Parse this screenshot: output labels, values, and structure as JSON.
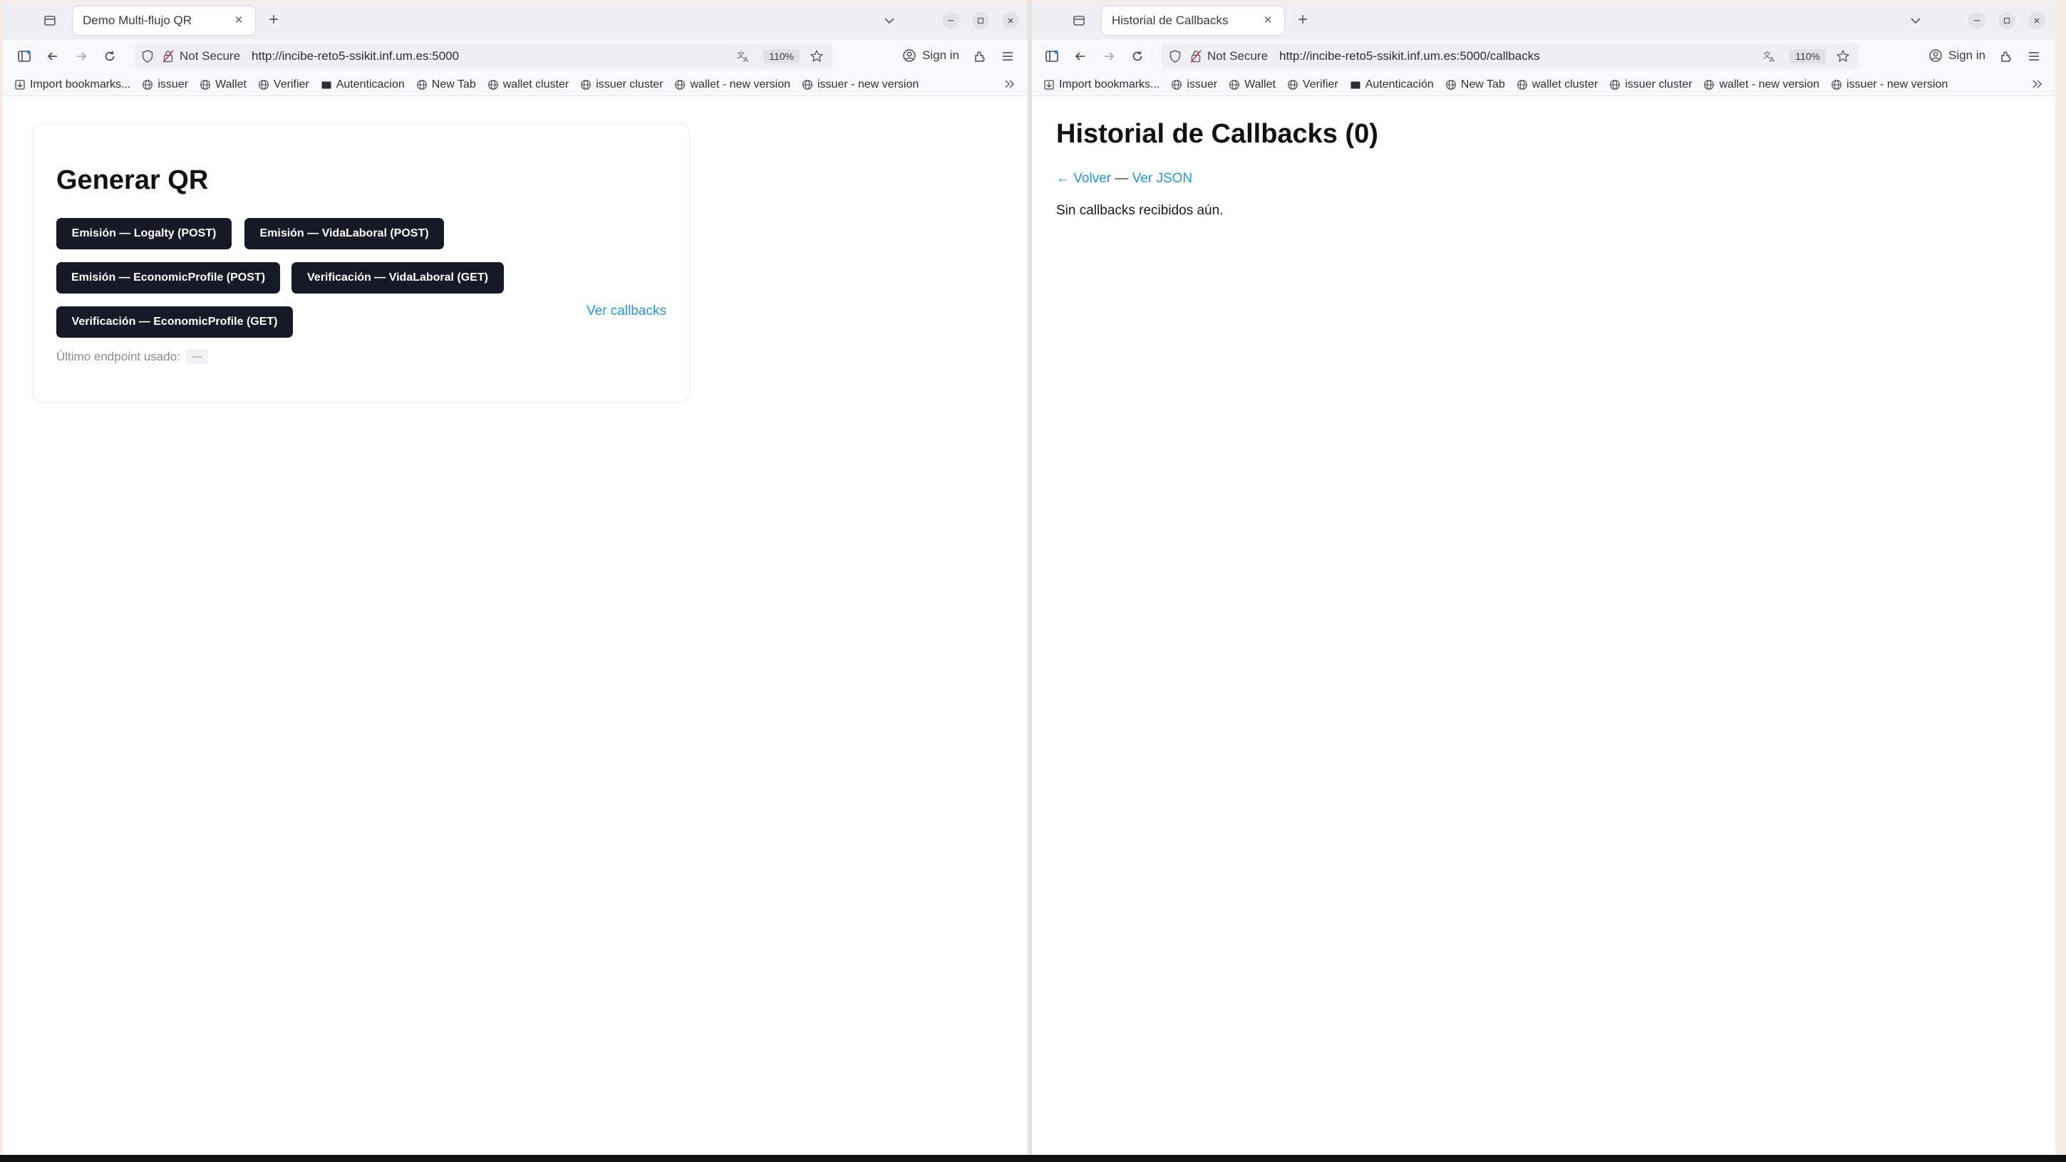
{
  "left": {
    "tab": {
      "title": "Demo Multi-flujo QR",
      "close": "×"
    },
    "new_tab": "+",
    "urlbar": {
      "not_secure": "Not Secure",
      "url": "http://incibe-reto5-ssikit.inf.um.es:5000",
      "zoom": "110%"
    },
    "sign_in": "Sign in",
    "bookmarks": [
      "Import bookmarks...",
      "issuer",
      "Wallet",
      "Verifier",
      "Autenticacion",
      "New Tab",
      "wallet cluster",
      "issuer cluster",
      "wallet - new version",
      "issuer - new version"
    ],
    "page": {
      "title": "Generar QR",
      "buttons": [
        "Emisión — Logalty (POST)",
        "Emisión — VidaLaboral (POST)",
        "Emisión — EconomicProfile (POST)",
        "Verificación — VidaLaboral (GET)",
        "Verificación — EconomicProfile (GET)"
      ],
      "ver_callbacks": "Ver callbacks",
      "last_endpoint_label": "Último endpoint usado:",
      "last_endpoint_value": "—"
    }
  },
  "right": {
    "tab": {
      "title": "Historial de Callbacks",
      "close": "×"
    },
    "new_tab": "+",
    "urlbar": {
      "not_secure": "Not Secure",
      "url": "http://incibe-reto5-ssikit.inf.um.es:5000/callbacks",
      "zoom": "110%"
    },
    "sign_in": "Sign in",
    "bookmarks": [
      "Import bookmarks...",
      "issuer",
      "Wallet",
      "Verifier",
      "Autenticación",
      "New Tab",
      "wallet cluster",
      "issuer cluster",
      "wallet - new version",
      "issuer - new version"
    ],
    "page": {
      "title": "Historial de Callbacks (0)",
      "back_link": "← Volver",
      "separator": " — ",
      "json_link": "Ver JSON",
      "empty_message": "Sin callbacks recibidos aún."
    }
  },
  "icons": {
    "shield": "shield-icon",
    "lock": "lock-icon",
    "star": "star-icon",
    "globe": "globe-icon",
    "back": "back-arrow-icon",
    "forward": "forward-arrow-icon",
    "reload": "reload-icon"
  },
  "colors": {
    "button_bg": "#151a26",
    "link": "#2696d8",
    "tabstrip_bg": "#f0f0f4"
  }
}
